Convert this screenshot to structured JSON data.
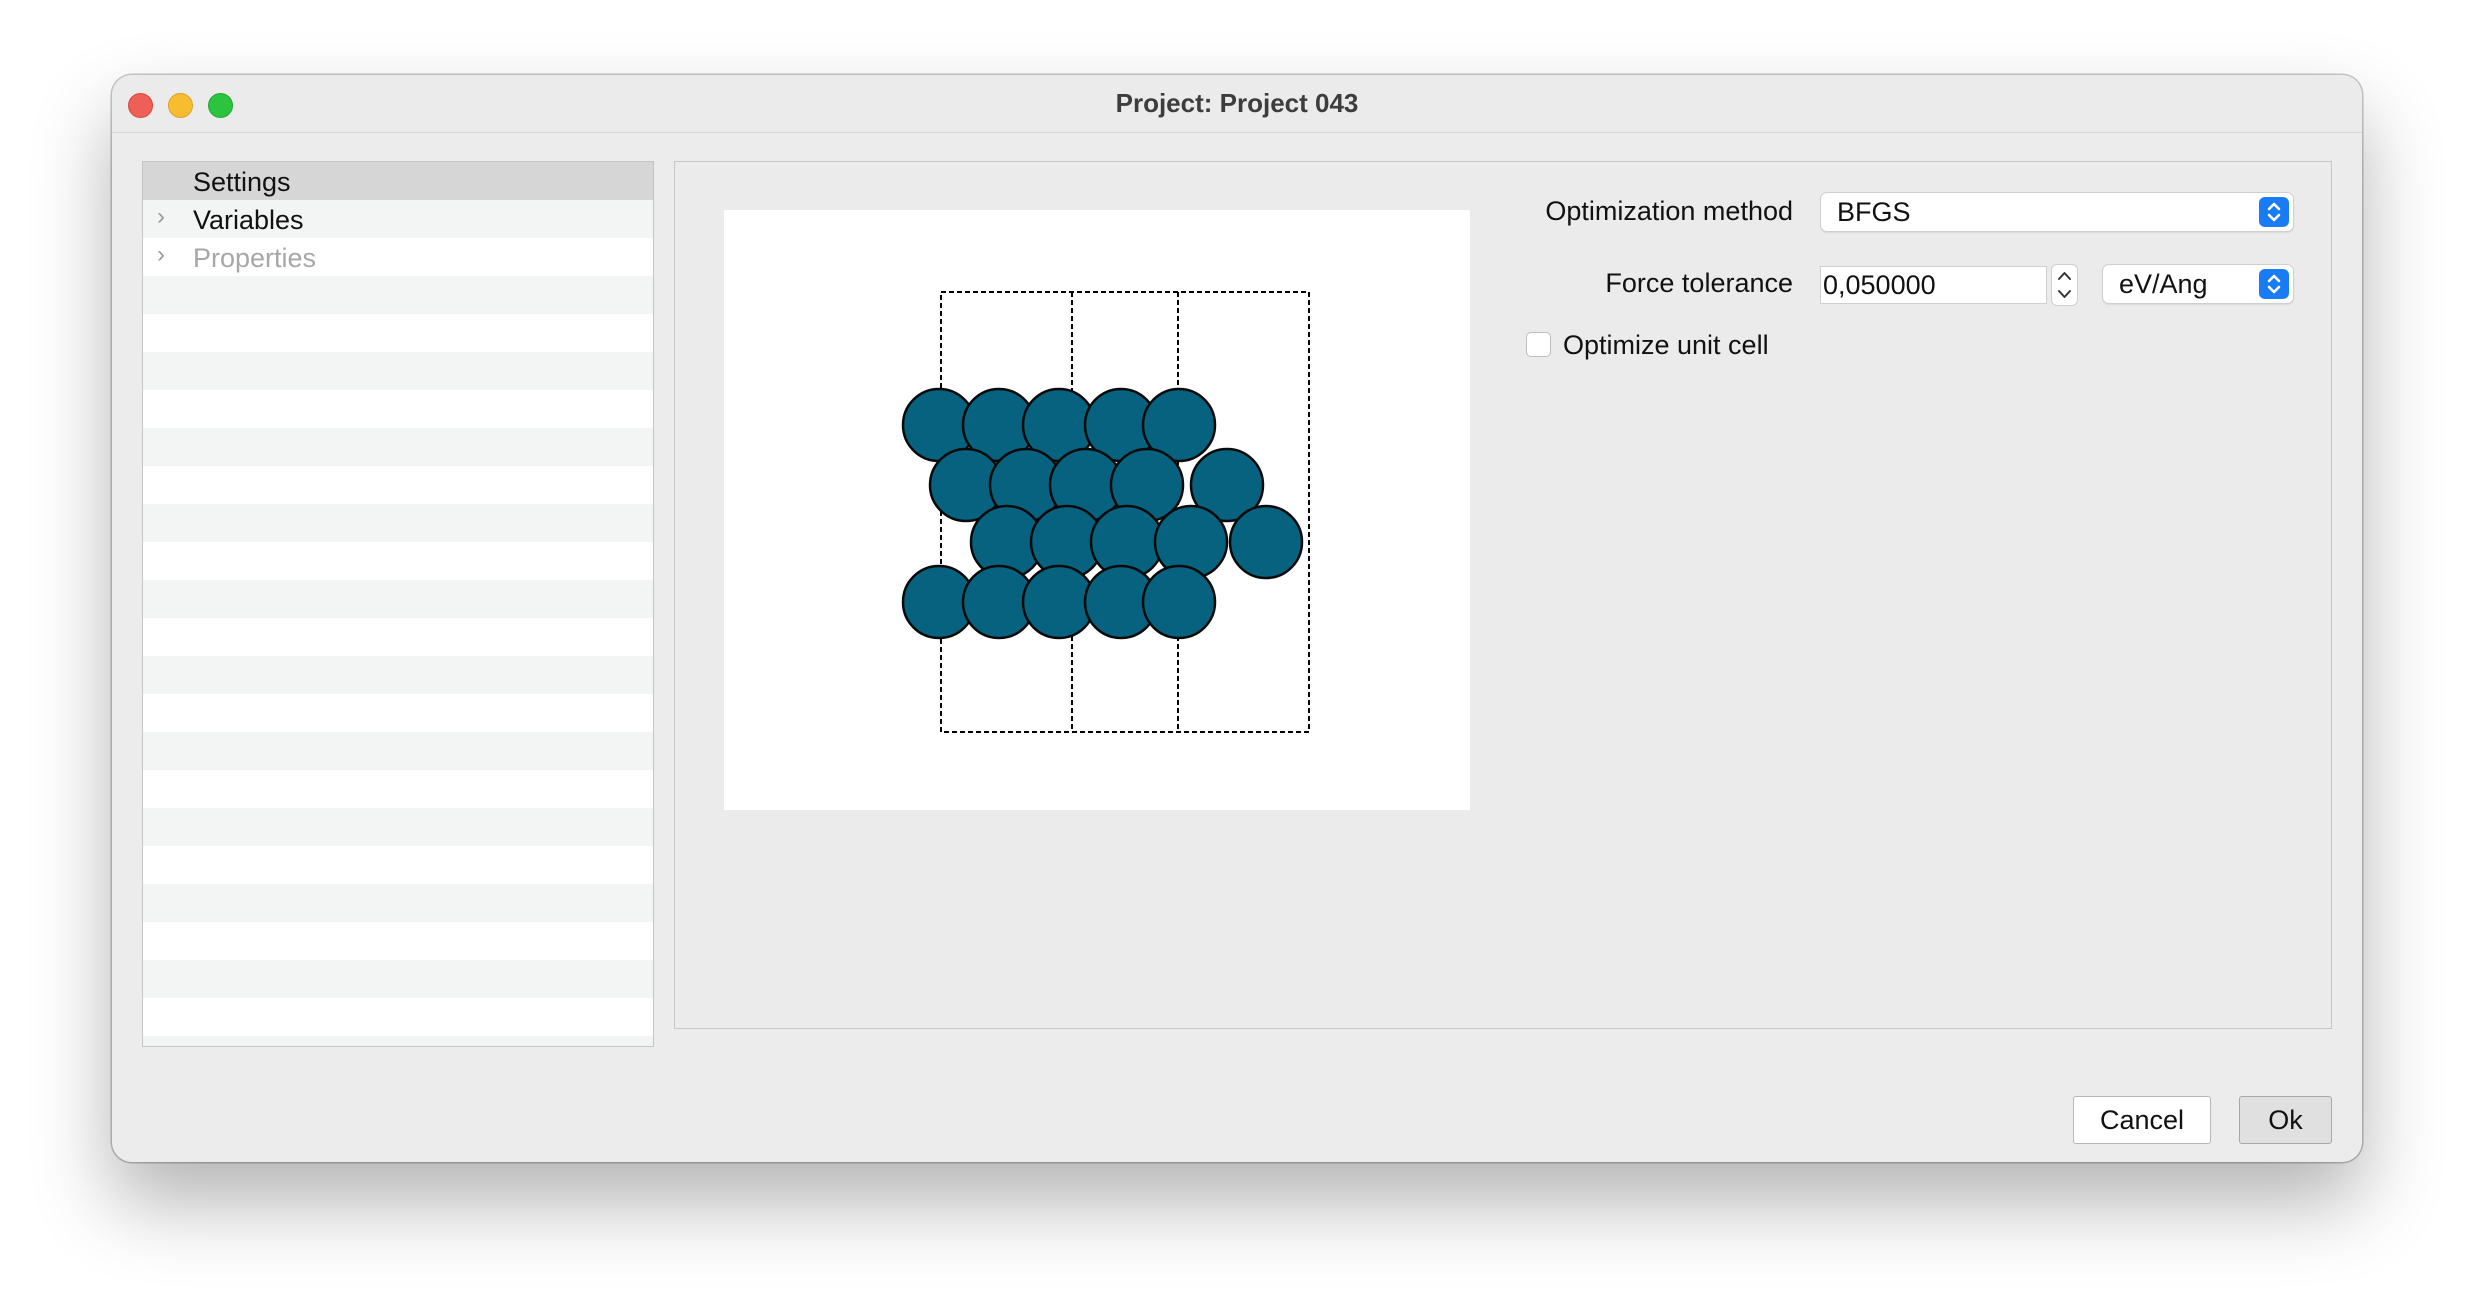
{
  "window": {
    "title": "Project: Project 043"
  },
  "tree": {
    "items": [
      {
        "label": "Settings",
        "expandable": false,
        "selected": true,
        "enabled": true
      },
      {
        "label": "Variables",
        "expandable": true,
        "selected": false,
        "enabled": true
      },
      {
        "label": "Properties",
        "expandable": true,
        "selected": false,
        "enabled": false
      }
    ]
  },
  "form": {
    "optimization_method": {
      "label": "Optimization method",
      "value": "BFGS"
    },
    "force_tolerance": {
      "label": "Force tolerance",
      "value": "0,050000",
      "unit": "eV/Ang"
    },
    "optimize_unit_cell": {
      "label": "Optimize unit cell",
      "checked": false
    }
  },
  "buttons": {
    "cancel": "Cancel",
    "ok": "Ok"
  },
  "colors": {
    "atom": "#06627f",
    "select_accent": "#1a7cf5"
  }
}
